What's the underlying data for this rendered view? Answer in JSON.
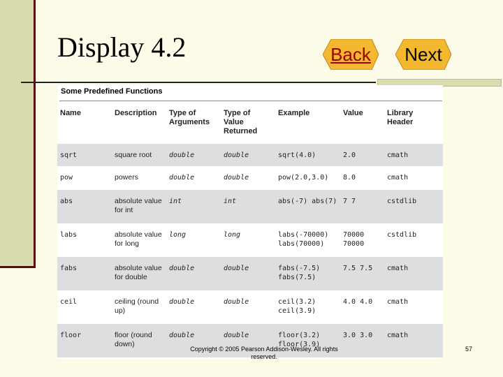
{
  "slide": {
    "title": "Display 4.2",
    "nav": {
      "back_label": "Back",
      "next_label": "Next"
    },
    "footer": "Copyright © 2005 Pearson Addison-Wesley. All rights reserved.",
    "page_number": "57"
  },
  "table": {
    "caption": "Some Predefined Functions",
    "headers": [
      "Name",
      "Description",
      "Type of Arguments",
      "Type of Value Returned",
      "Example",
      "Value",
      "Library Header"
    ],
    "rows": [
      [
        "sqrt",
        "square root",
        "double",
        "double",
        "sqrt(4.0)",
        "2.0",
        "cmath"
      ],
      [
        "pow",
        "powers",
        "double",
        "double",
        "pow(2.0,3.0)",
        "8.0",
        "cmath"
      ],
      [
        "abs",
        "absolute value for int",
        "int",
        "int",
        "abs(-7) abs(7)",
        "7 7",
        "cstdlib"
      ],
      [
        "labs",
        "absolute value for long",
        "long",
        "long",
        "labs(-70000) labs(70000)",
        "70000 70000",
        "cstdlib"
      ],
      [
        "fabs",
        "absolute value for double",
        "double",
        "double",
        "fabs(-7.5) fabs(7.5)",
        "7.5 7.5",
        "cmath"
      ],
      [
        "ceil",
        "ceiling (round up)",
        "double",
        "double",
        "ceil(3.2) ceil(3.9)",
        "4.0 4.0",
        "cmath"
      ],
      [
        "floor",
        "floor (round down)",
        "double",
        "double",
        "floor(3.2) floor(3.9)",
        "3.0 3.0",
        "cmath"
      ]
    ]
  },
  "colors": {
    "background": "#fbfbe8",
    "accent": "#5b0b0b",
    "sidebar": "#dbdbb0",
    "row_shade": "#dcdee0",
    "nav_arrow": "#f4b830"
  }
}
